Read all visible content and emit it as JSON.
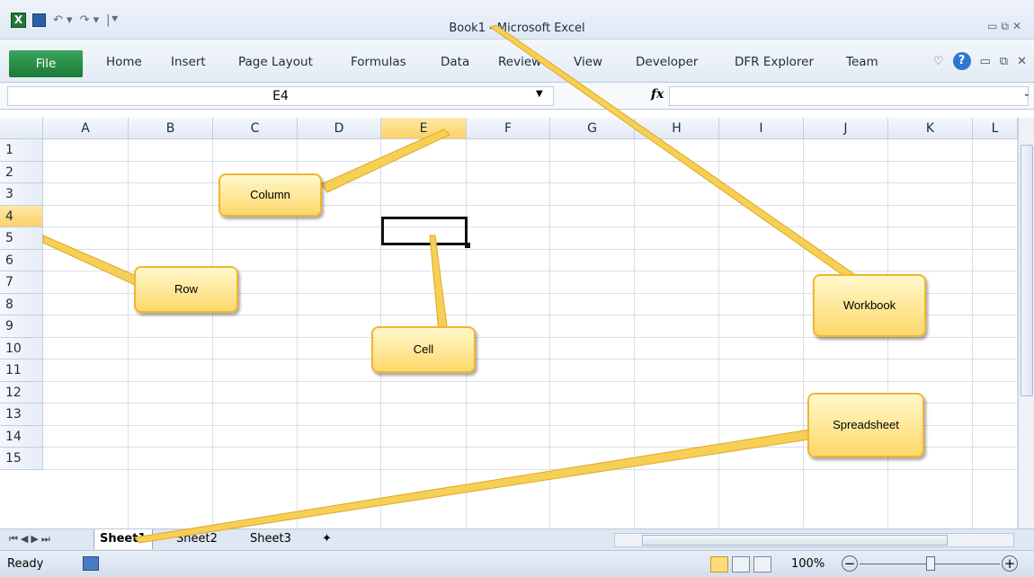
{
  "window": {
    "title": "Book1  -  Microsoft Excel",
    "file_tab": "File"
  },
  "ribbon": {
    "tabs": [
      "Home",
      "Insert",
      "Page Layout",
      "Formulas",
      "Data",
      "Review",
      "View",
      "Developer",
      "DFR Explorer",
      "Team"
    ]
  },
  "formula_bar": {
    "name_box": "E4",
    "fx_label": "fx",
    "formula": ""
  },
  "grid": {
    "columns": [
      "A",
      "B",
      "C",
      "D",
      "E",
      "F",
      "G",
      "H",
      "I",
      "J",
      "K",
      "L"
    ],
    "rows": [
      "1",
      "2",
      "3",
      "4",
      "5",
      "6",
      "7",
      "8",
      "9",
      "10",
      "11",
      "12",
      "13",
      "14",
      "15"
    ],
    "selected_column": "E",
    "selected_row": "4",
    "active_cell": "E4"
  },
  "sheets": {
    "tabs": [
      "Sheet1",
      "Sheet2",
      "Sheet3"
    ],
    "active": "Sheet1"
  },
  "status_bar": {
    "status": "Ready",
    "zoom": "100%"
  },
  "callouts": {
    "column": "Column",
    "row": "Row",
    "cell": "Cell",
    "workbook": "Workbook",
    "spreadsheet": "Spreadsheet"
  },
  "colors": {
    "callout_fill": "#fdd86a",
    "callout_border": "#f0b630",
    "selection": "#fcd167",
    "file_tab": "#1b7a37"
  }
}
